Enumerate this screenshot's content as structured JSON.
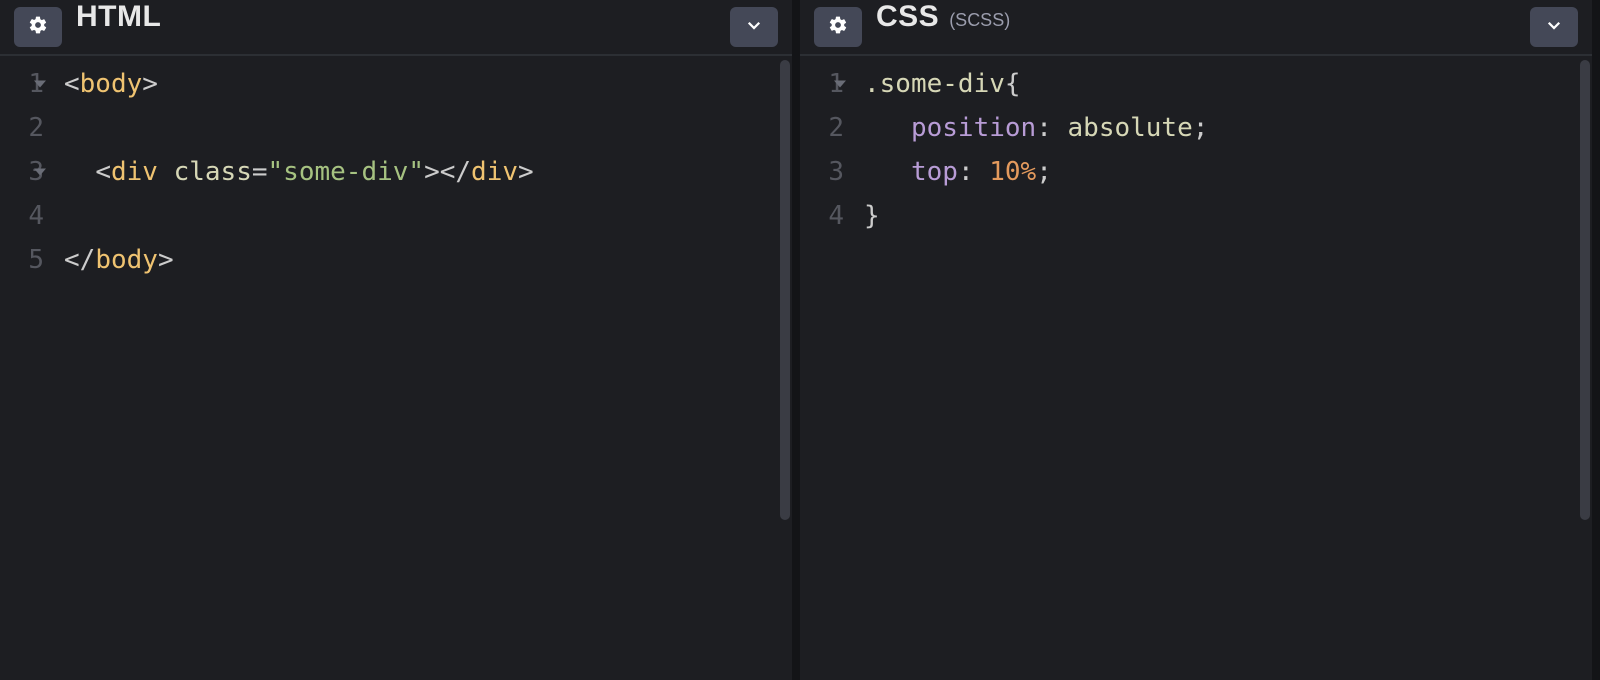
{
  "panels": [
    {
      "title": "HTML",
      "subtitle": "",
      "gutter": [
        "1",
        "2",
        "3",
        "4",
        "5"
      ],
      "fold_lines": [
        0,
        2
      ],
      "code_rows": [
        [
          {
            "cls": "tok-punct",
            "t": "<"
          },
          {
            "cls": "tok-tag",
            "t": "body"
          },
          {
            "cls": "tok-punct",
            "t": ">"
          }
        ],
        [],
        [
          {
            "cls": "",
            "t": "  "
          },
          {
            "cls": "tok-punct",
            "t": "<"
          },
          {
            "cls": "tok-tag",
            "t": "div"
          },
          {
            "cls": "",
            "t": " "
          },
          {
            "cls": "tok-attr",
            "t": "class"
          },
          {
            "cls": "tok-punct",
            "t": "="
          },
          {
            "cls": "tok-string",
            "t": "\"some-div\""
          },
          {
            "cls": "tok-punct",
            "t": ">"
          },
          {
            "cls": "tok-punct",
            "t": "</"
          },
          {
            "cls": "tok-tag",
            "t": "div"
          },
          {
            "cls": "tok-punct",
            "t": ">"
          }
        ],
        [],
        [
          {
            "cls": "tok-punct",
            "t": "</"
          },
          {
            "cls": "tok-tag",
            "t": "body"
          },
          {
            "cls": "tok-punct",
            "t": ">"
          }
        ]
      ]
    },
    {
      "title": "CSS",
      "subtitle": "(SCSS)",
      "gutter": [
        "1",
        "2",
        "3",
        "4"
      ],
      "fold_lines": [
        0
      ],
      "code_rows": [
        [
          {
            "cls": "tok-sel",
            "t": ".some-div"
          },
          {
            "cls": "tok-punct",
            "t": "{"
          }
        ],
        [
          {
            "cls": "",
            "t": "   "
          },
          {
            "cls": "tok-prop",
            "t": "position"
          },
          {
            "cls": "tok-punct",
            "t": ": "
          },
          {
            "cls": "tok-val",
            "t": "absolute"
          },
          {
            "cls": "tok-punct",
            "t": ";"
          }
        ],
        [
          {
            "cls": "",
            "t": "   "
          },
          {
            "cls": "tok-prop",
            "t": "top"
          },
          {
            "cls": "tok-punct",
            "t": ": "
          },
          {
            "cls": "tok-num",
            "t": "10%"
          },
          {
            "cls": "tok-punct",
            "t": ";"
          }
        ],
        [
          {
            "cls": "tok-punct",
            "t": "}"
          }
        ]
      ]
    }
  ]
}
